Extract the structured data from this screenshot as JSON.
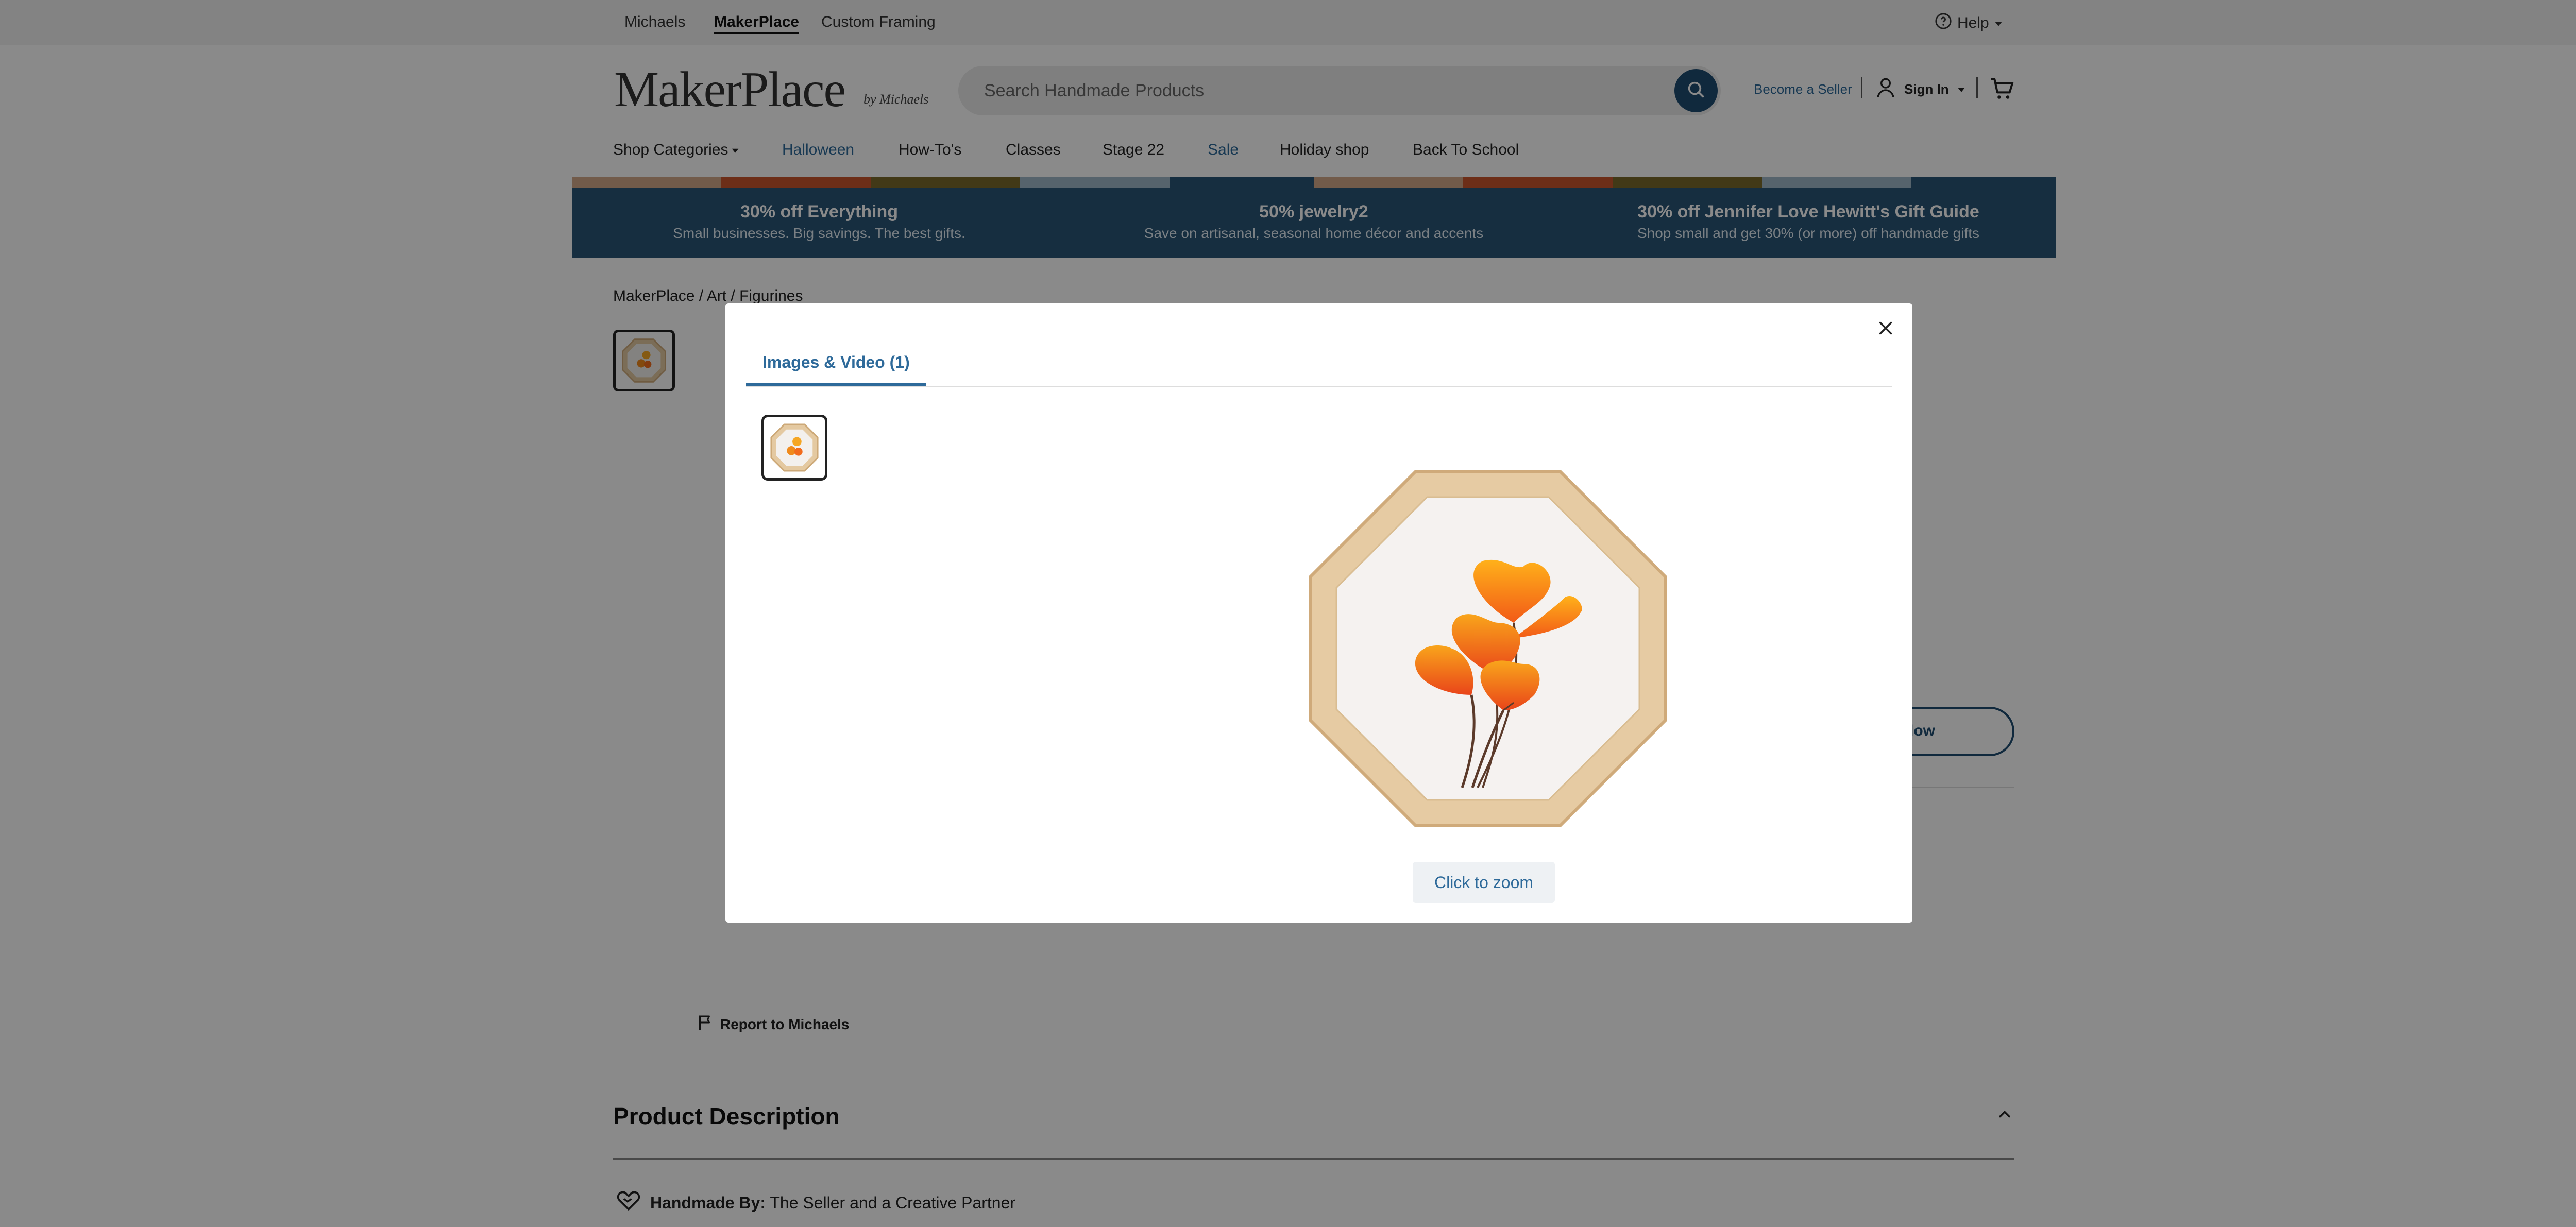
{
  "utility": {
    "links": [
      "Michaels",
      "MakerPlace",
      "Custom Framing"
    ],
    "help": "Help"
  },
  "header": {
    "logo": "MakerPlace",
    "logo_sub": "by Michaels",
    "search_placeholder": "Search Handmade Products",
    "become_seller": "Become a Seller",
    "sign_in": "Sign In"
  },
  "nav": {
    "items": [
      "Shop Categories",
      "Halloween",
      "How-To's",
      "Classes",
      "Stage 22",
      "Sale",
      "Holiday shop",
      "Back To School"
    ]
  },
  "promo": {
    "stripe_colors": [
      "#d3a98a",
      "#c9552e",
      "#7a6a2c",
      "#9fb7c8"
    ],
    "items": [
      {
        "title": "30% off Everything",
        "subtitle": "Small businesses. Big savings. The best gifts."
      },
      {
        "title": "50% jewelry2",
        "subtitle": "Save on artisanal, seasonal home décor and accents"
      },
      {
        "title": "30% off Jennifer Love Hewitt's Gift Guide",
        "subtitle": "Shop small and get 30% (or more) off handmade gifts"
      }
    ]
  },
  "product": {
    "breadcrumb": "MakerPlace / Art / Figurines",
    "follow_partial": "low",
    "report": "Report to Michaels",
    "description_title": "Product Description",
    "handmade_label": "Handmade By:",
    "handmade_value": "The Seller and a Creative Partner"
  },
  "modal": {
    "tab_label": "Images & Video (1)",
    "zoom_label": "Click to zoom"
  },
  "colors": {
    "brand_blue": "#1f4d72",
    "link_blue": "#2e6a9a",
    "promo_bg": "#2a5577"
  }
}
